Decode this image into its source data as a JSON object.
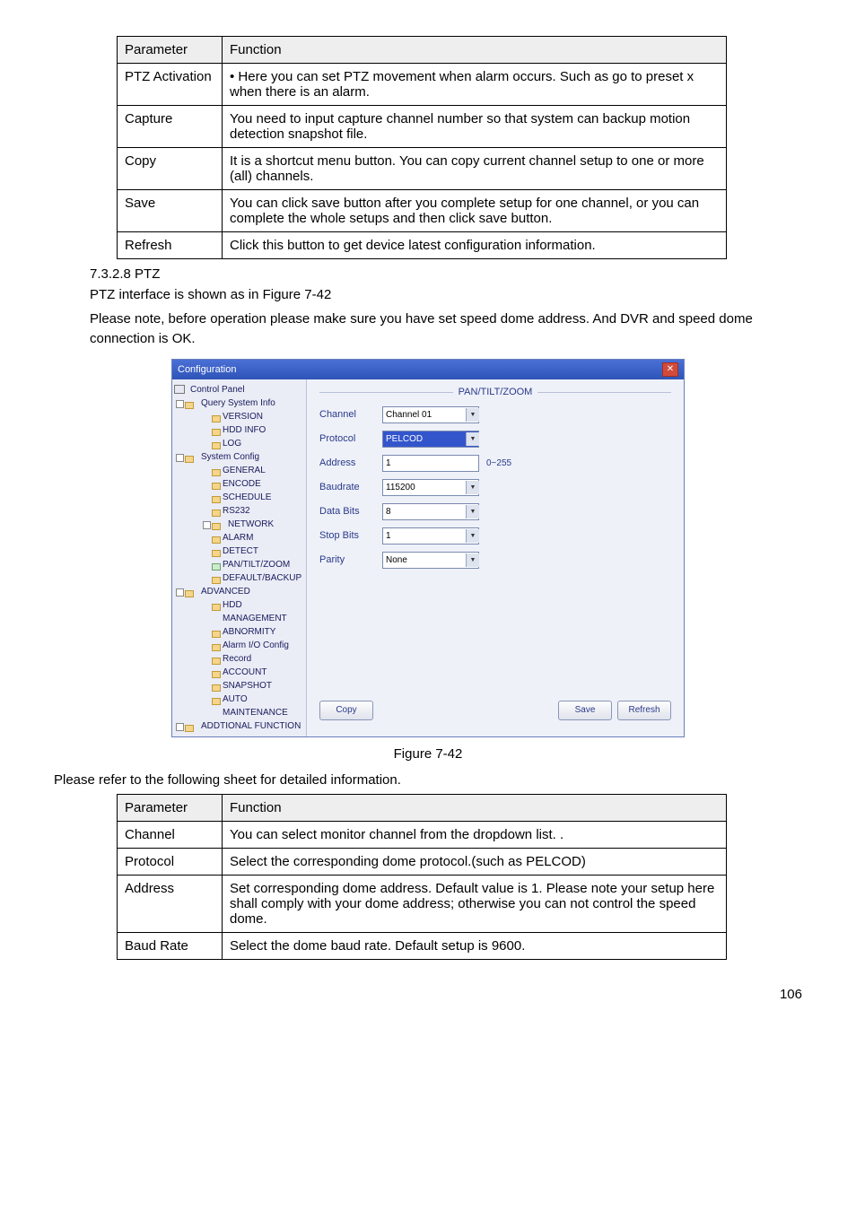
{
  "table1": {
    "head": [
      "Parameter",
      "Function"
    ],
    "rows": [
      [
        "PTZ Activation",
        "• Here you can set PTZ movement when alarm occurs. Such as go to preset x when there is an alarm."
      ],
      [
        "Capture",
        "You need to input capture channel number so that system can backup motion detection snapshot file."
      ],
      [
        "Copy",
        "It is a shortcut menu button. You can copy current channel setup to one or more (all) channels."
      ],
      [
        "Save",
        "You can click save button after you complete setup for one channel, or you can complete the whole setups and then click save button."
      ],
      [
        "Refresh",
        "Click this button to get device latest configuration information."
      ]
    ]
  },
  "section_heading": "7.3.2.8  PTZ",
  "para1": "PTZ interface is shown as in Figure 7-42",
  "para2": "Please note, before operation please make sure you have set speed dome address. And DVR and speed dome connection is OK.",
  "config": {
    "title": "Configuration",
    "tree": {
      "root": "Control Panel",
      "g1": "Query System Info",
      "g1_items": [
        "VERSION",
        "HDD INFO",
        "LOG"
      ],
      "g2": "System Config",
      "g2_items": [
        "GENERAL",
        "ENCODE",
        "SCHEDULE",
        "RS232",
        "NETWORK",
        "ALARM",
        "DETECT",
        "PAN/TILT/ZOOM",
        "DEFAULT/BACKUP"
      ],
      "g3": "ADVANCED",
      "g3_items": [
        "HDD MANAGEMENT",
        "ABNORMITY",
        "Alarm I/O Config",
        "Record",
        "ACCOUNT",
        "SNAPSHOT",
        "AUTO MAINTENANCE"
      ],
      "g4": "ADDTIONAL FUNCTION"
    },
    "fieldset_title": "PAN/TILT/ZOOM",
    "rows": [
      {
        "label": "Channel",
        "value": "Channel 01",
        "dropdown": true
      },
      {
        "label": "Protocol",
        "value": "PELCOD",
        "dropdown": true,
        "selected": true
      },
      {
        "label": "Address",
        "value": "1",
        "dropdown": false,
        "hint": "0~255"
      },
      {
        "label": "Baudrate",
        "value": "115200",
        "dropdown": true
      },
      {
        "label": "Data Bits",
        "value": "8",
        "dropdown": true
      },
      {
        "label": "Stop Bits",
        "value": "1",
        "dropdown": true
      },
      {
        "label": "Parity",
        "value": "None",
        "dropdown": true
      }
    ],
    "buttons": {
      "copy": "Copy",
      "save": "Save",
      "refresh": "Refresh"
    }
  },
  "figure_caption": "Figure 7-42",
  "para3": "Please refer to the following sheet for detailed information.",
  "table2": {
    "head": [
      "Parameter",
      "Function"
    ],
    "rows": [
      [
        "Channel",
        "You can select monitor channel from the dropdown list. ."
      ],
      [
        "Protocol",
        "Select the corresponding dome protocol.(such as PELCOD)"
      ],
      [
        "Address",
        "Set corresponding dome address. Default value is 1. Please note your setup here shall comply with your dome address; otherwise you can not control the speed dome."
      ],
      [
        "Baud Rate",
        "Select the dome baud rate. Default setup is 9600."
      ]
    ]
  },
  "page_number": "106"
}
